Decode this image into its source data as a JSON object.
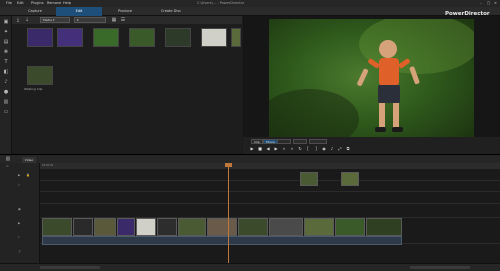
{
  "titlebar": {
    "menu": [
      "File",
      "Edit",
      "Plugins",
      "Remove",
      "Help"
    ],
    "doc_title": "C:\\Users\\... - PowerDirector"
  },
  "modebar": {
    "tabs": [
      "Capture",
      "Edit",
      "Produce",
      "Create Disc"
    ],
    "active_tab": "Edit",
    "brand_small": "",
    "brand": "PowerDirector"
  },
  "library": {
    "filter": "Media",
    "dropdown2": "",
    "items": [
      {
        "label": "",
        "color": "#3b2a6a"
      },
      {
        "label": "",
        "color": "#44307a"
      },
      {
        "label": "",
        "color": "#3a6a2a"
      },
      {
        "label": "",
        "color": "#3a5a2a"
      },
      {
        "label": "",
        "color": "#2d3a2a"
      },
      {
        "label": "",
        "color": "#d0d0c8"
      },
      {
        "label": "",
        "color": "#5a6a3a"
      },
      {
        "label": "",
        "color": "#4a4a4a"
      },
      {
        "label": "Walking Clip",
        "color": "#3a4a2a"
      }
    ]
  },
  "preview": {
    "mode_clip": "Clip",
    "mode_movie": "Movie",
    "chip3": "",
    "chip4": "",
    "timecode": ""
  },
  "timeline": {
    "tab": "Video",
    "ruler": [
      "00:00:00",
      "",
      "",
      "",
      "",
      "",
      "",
      "",
      "",
      "",
      ""
    ]
  },
  "colors": {
    "accent": "#1e4f7a",
    "playhead": "#c0783a"
  }
}
